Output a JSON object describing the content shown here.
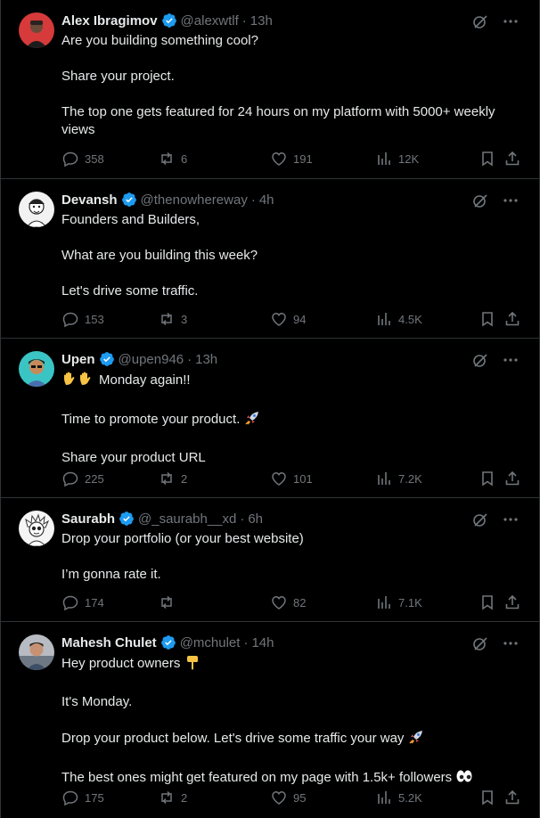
{
  "tweets": [
    {
      "name": "Alex Ibragimov",
      "handle": "@alexwtlf",
      "time": "13h",
      "lines": [
        "Are you building something cool?",
        "Share your project.",
        "The top one gets featured for 24 hours on my platform with 5000+ weekly views"
      ],
      "replies": "358",
      "reposts": "6",
      "likes": "191",
      "views": "12K",
      "avatar_color": "#d63a3a"
    },
    {
      "name": "Devansh",
      "handle": "@thenowhereway",
      "time": "4h",
      "lines": [
        "Founders and Builders,",
        "What are you building this week?",
        "Let's drive some traffic."
      ],
      "replies": "153",
      "reposts": "3",
      "likes": "94",
      "views": "4.5K",
      "avatar_color": "#f2f2f2"
    },
    {
      "name": "Upen",
      "handle": "@upen946",
      "time": "13h",
      "lines": [
        "Monday again!!",
        "Time to promote your product.",
        "Share your product URL"
      ],
      "replies": "225",
      "reposts": "2",
      "likes": "101",
      "views": "7.2K",
      "avatar_color": "#3bc4c4"
    },
    {
      "name": "Saurabh",
      "handle": "@_saurabh__xd",
      "time": "6h",
      "lines": [
        "Drop your portfolio (or your best website)",
        "I’m gonna rate it."
      ],
      "replies": "174",
      "reposts": "",
      "likes": "82",
      "views": "7.1K",
      "avatar_color": "#f5f5f5"
    },
    {
      "name": "Mahesh Chulet",
      "handle": "@mchulet",
      "time": "14h",
      "lines": [
        "Hey product owners",
        "It's Monday.",
        "Drop your product below. Let's drive some traffic your way",
        "The best ones might get featured on my page with 1.5k+ followers"
      ],
      "replies": "175",
      "reposts": "2",
      "likes": "95",
      "views": "5.2K",
      "avatar_color": "#8a8f96"
    }
  ],
  "colors": {
    "background": "#000000",
    "text": "#e7e9ea",
    "muted": "#71767b",
    "verified": "#1d9bf0",
    "divider": "#2f3336"
  },
  "icons": [
    "grok-icon",
    "more-icon",
    "reply-icon",
    "repost-icon",
    "like-icon",
    "views-icon",
    "bookmark-icon",
    "share-icon",
    "verified-badge-icon"
  ]
}
